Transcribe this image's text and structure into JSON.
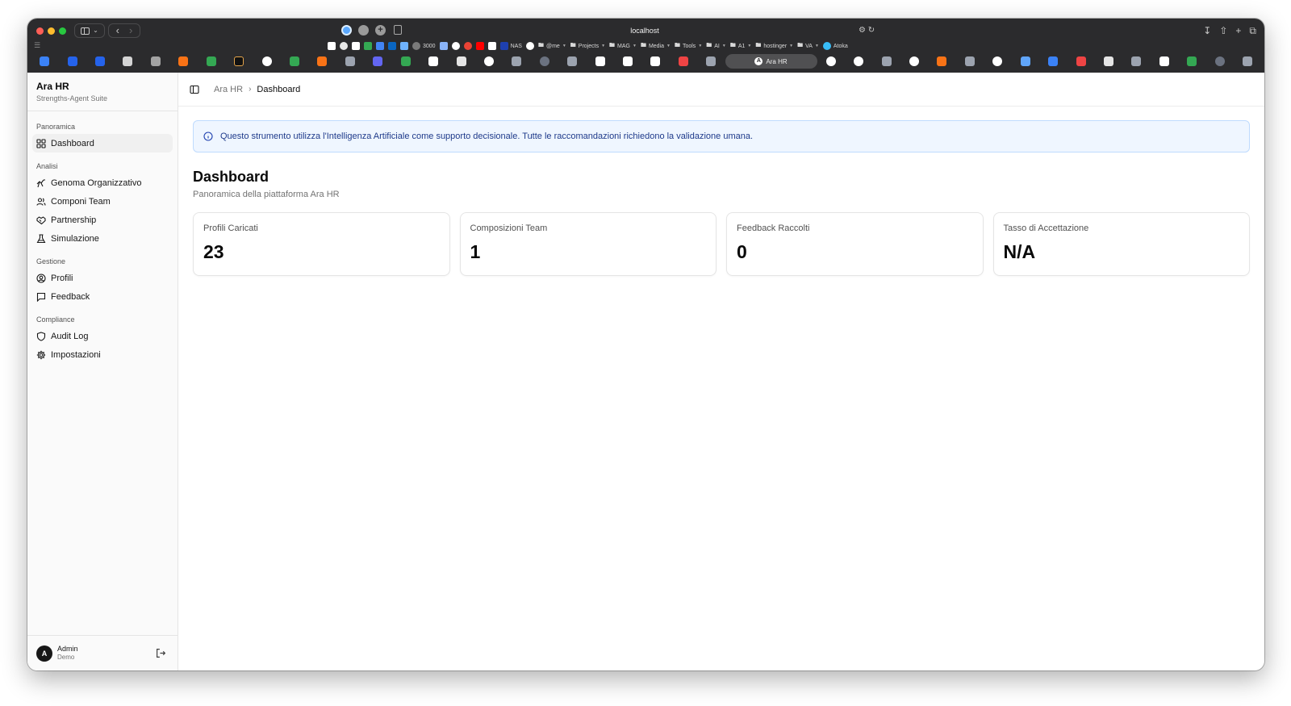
{
  "browser": {
    "address": "localhost",
    "active_tab_title": "Ara HR",
    "bookmarks": [
      {
        "label": "3000"
      },
      {
        "label": "NAS"
      },
      {
        "label": "@me",
        "folder": true
      },
      {
        "label": "Projects",
        "folder": true
      },
      {
        "label": "MAG",
        "folder": true
      },
      {
        "label": "Media",
        "folder": true
      },
      {
        "label": "Tools",
        "folder": true
      },
      {
        "label": "AI",
        "folder": true
      },
      {
        "label": "A1",
        "folder": true
      },
      {
        "label": "hostinger",
        "folder": true
      },
      {
        "label": "VA",
        "folder": true
      },
      {
        "label": "Atoka"
      }
    ]
  },
  "app": {
    "title": "Ara HR",
    "subtitle": "Strengths-Agent Suite"
  },
  "sidebar": {
    "groups": [
      {
        "label": "Panoramica",
        "items": [
          {
            "label": "Dashboard",
            "icon": "grid-icon",
            "active": true
          }
        ]
      },
      {
        "label": "Analisi",
        "items": [
          {
            "label": "Genoma Organizzativo",
            "icon": "network-icon"
          },
          {
            "label": "Componi Team",
            "icon": "users-icon"
          },
          {
            "label": "Partnership",
            "icon": "handshake-icon"
          },
          {
            "label": "Simulazione",
            "icon": "flask-icon"
          }
        ]
      },
      {
        "label": "Gestione",
        "items": [
          {
            "label": "Profili",
            "icon": "user-circle-icon"
          },
          {
            "label": "Feedback",
            "icon": "message-icon"
          }
        ]
      },
      {
        "label": "Compliance",
        "items": [
          {
            "label": "Audit Log",
            "icon": "shield-icon"
          },
          {
            "label": "Impostazioni",
            "icon": "gear-icon"
          }
        ]
      }
    ],
    "user": {
      "initial": "A",
      "name": "Admin",
      "role": "Demo"
    }
  },
  "breadcrumb": {
    "root": "Ara HR",
    "current": "Dashboard"
  },
  "notice": "Questo strumento utilizza l'Intelligenza Artificiale come supporto decisionale. Tutte le raccomandazioni richiedono la validazione umana.",
  "page": {
    "title": "Dashboard",
    "subtitle": "Panoramica della piattaforma Ara HR"
  },
  "stats": [
    {
      "label": "Profili Caricati",
      "value": "23"
    },
    {
      "label": "Composizioni Team",
      "value": "1"
    },
    {
      "label": "Feedback Raccolti",
      "value": "0"
    },
    {
      "label": "Tasso di Accettazione",
      "value": "N/A"
    }
  ],
  "colors": {
    "notice_bg": "#eff6ff",
    "notice_text": "#1e3a8a",
    "sidebar_bg": "#fafafa",
    "chrome_bg": "#2b2b2d"
  }
}
